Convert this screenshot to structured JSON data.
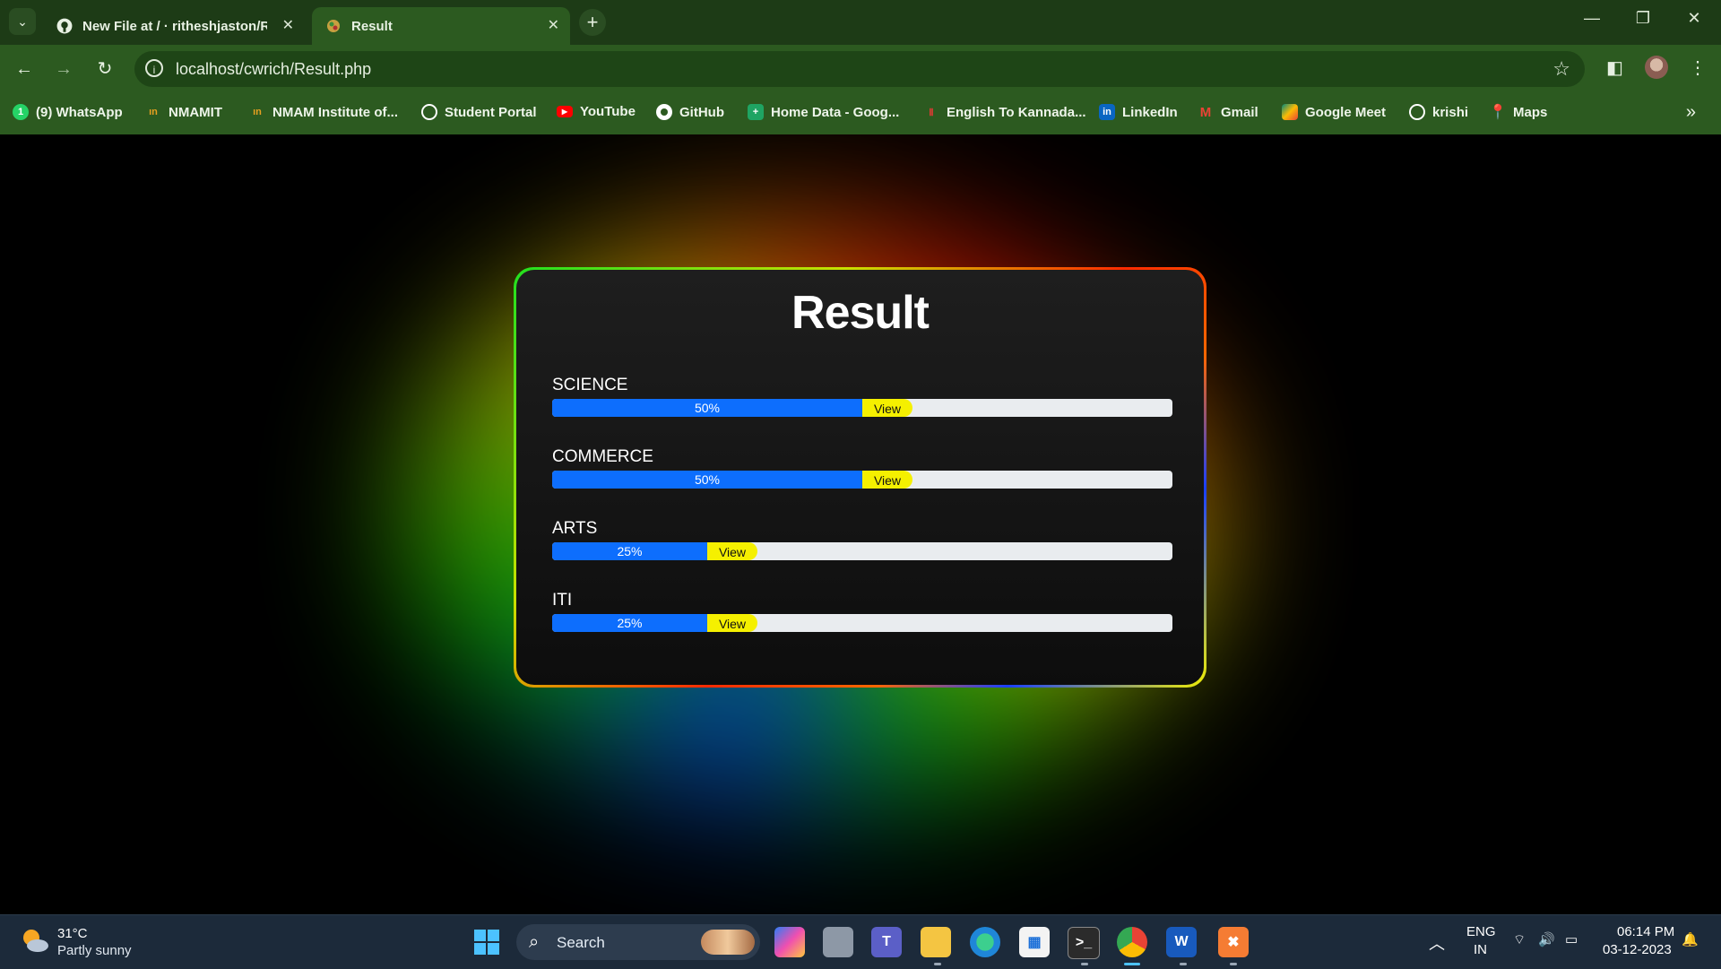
{
  "browser": {
    "tabs": [
      {
        "label": "New File at / · ritheshjaston/Ri",
        "active": false
      },
      {
        "label": "Result",
        "active": true
      }
    ],
    "url": "localhost/cwrich/Result.php",
    "bookmarks": [
      {
        "label": "(9) WhatsApp",
        "icon": "whatsapp-icon",
        "color": "#25d366"
      },
      {
        "label": "NMAMIT",
        "icon": "nmamit-icon",
        "color": "#e8a020"
      },
      {
        "label": "NMAM Institute of...",
        "icon": "nmamit-icon",
        "color": "#e8a020"
      },
      {
        "label": "Student Portal",
        "icon": "globe-icon",
        "color": "#ffffff"
      },
      {
        "label": "YouTube",
        "icon": "youtube-icon",
        "color": "#ff0000"
      },
      {
        "label": "GitHub",
        "icon": "github-icon",
        "color": "#ffffff"
      },
      {
        "label": "Home Data - Goog...",
        "icon": "sheets-icon",
        "color": "#1fa463"
      },
      {
        "label": "English To Kannada...",
        "icon": "translate-icon",
        "color": "#e53935"
      },
      {
        "label": "LinkedIn",
        "icon": "linkedin-icon",
        "color": "#0a66c2"
      },
      {
        "label": "Gmail",
        "icon": "gmail-icon",
        "color": "#ea4335"
      },
      {
        "label": "Google Meet",
        "icon": "meet-icon",
        "color": "#00897b"
      },
      {
        "label": "krishi",
        "icon": "globe-icon",
        "color": "#ffffff"
      },
      {
        "label": "Maps",
        "icon": "maps-icon",
        "color": "#34a853"
      }
    ]
  },
  "page": {
    "title": "Result",
    "view_label": "View",
    "subjects": [
      {
        "name": "SCIENCE",
        "percent_label": "50%",
        "fraction": 0.5
      },
      {
        "name": "COMMERCE",
        "percent_label": "50%",
        "fraction": 0.5
      },
      {
        "name": "ARTS",
        "percent_label": "25%",
        "fraction": 0.25
      },
      {
        "name": "ITI",
        "percent_label": "25%",
        "fraction": 0.25
      }
    ],
    "colors": {
      "bar_fill": "#0d6efd",
      "view_badge": "#f5f000",
      "bar_track": "#e9ecef"
    }
  },
  "taskbar": {
    "weather": {
      "temp": "31°C",
      "desc": "Partly sunny"
    },
    "search_label": "Search",
    "language": {
      "top": "ENG",
      "bottom": "IN"
    },
    "time": "06:14 PM",
    "date": "03-12-2023"
  }
}
